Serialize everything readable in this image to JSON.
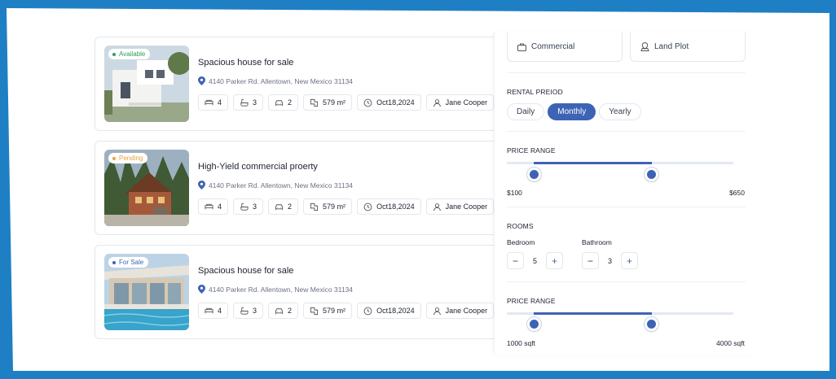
{
  "listings": [
    {
      "status": "Available",
      "status_color": "#2e9e5b",
      "title": "Spacious house for sale",
      "address": "4140 Parker Rd. Allentown, New Mexico 31134",
      "beds": "4",
      "baths": "3",
      "garage": "2",
      "area": "579 m²",
      "date": "Oct18,2024",
      "agent": "Jane Cooper"
    },
    {
      "status": "Pending",
      "status_color": "#e8a33b",
      "title": "High-Yield commercial proerty",
      "address": "4140 Parker Rd. Allentown, New Mexico 31134",
      "beds": "4",
      "baths": "3",
      "garage": "2",
      "area": "579 m²",
      "date": "Oct18,2024",
      "agent": "Jane Cooper"
    },
    {
      "status": "For Sale",
      "status_color": "#3d64b4",
      "title": "Spacious house for sale",
      "address": "4140 Parker Rd. Allentown, New Mexico 31134",
      "beds": "4",
      "baths": "3",
      "garage": "2",
      "area": "579 m²",
      "date": "Oct18,2024",
      "agent": "Jane Cooper"
    }
  ],
  "filters": {
    "property_types": [
      "Commercial",
      "Land Plot"
    ],
    "rental_period": {
      "label": "RENTAL PREIOD",
      "options": [
        "Daily",
        "Monthly",
        "Yearly"
      ],
      "selected": "Monthly"
    },
    "price_range": {
      "label": "PRICE RANGE",
      "min_label": "$100",
      "max_label": "$650",
      "low_fraction": 0.12,
      "high_fraction": 0.64
    },
    "rooms": {
      "label": "ROOMS",
      "bedroom_label": "Bedroom",
      "bedroom_value": "5",
      "bathroom_label": "Bathroom",
      "bathroom_value": "3"
    },
    "area_range": {
      "label": "PRICE RANGE",
      "min_label": "1000 sqft",
      "max_label": "4000 sqft",
      "low_fraction": 0.12,
      "high_fraction": 0.64
    }
  },
  "colors": {
    "accent": "#3d64b4",
    "frame": "#1f7fc4"
  },
  "icons": [
    "location-pin-icon",
    "bed-icon",
    "bath-icon",
    "car-icon",
    "area-icon",
    "clock-icon",
    "user-icon",
    "briefcase-icon",
    "land-plot-icon"
  ]
}
